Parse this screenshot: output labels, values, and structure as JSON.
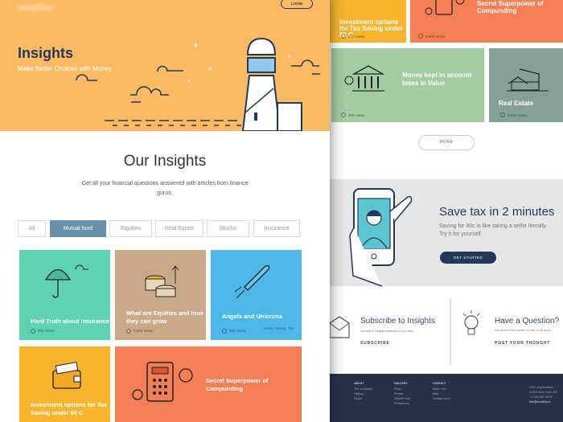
{
  "brand": {
    "logo": "wealthy"
  },
  "header": {
    "login": "LOGIN",
    "title": "Insights",
    "subtitle": "Make Better Choices with Money"
  },
  "section": {
    "title": "Our Insights",
    "description": "Get all your financial questions answered with articles from finance gurus."
  },
  "filters": [
    {
      "label": "All"
    },
    {
      "label": "Mutual fund",
      "active": true
    },
    {
      "label": "Equities"
    },
    {
      "label": "Real Estate"
    },
    {
      "label": "Stocks"
    },
    {
      "label": "Insurance"
    }
  ],
  "cards": [
    {
      "title": "Hard Truth about Insurance",
      "views": "200 Views",
      "color": "#5FD3B0",
      "icon": "umbrella-icon"
    },
    {
      "title": "What are Equities and how they can grow",
      "views": "3,500 Views",
      "color": "#C9A98A",
      "icon": "coins-icon"
    },
    {
      "title": "Angels and Unicrons",
      "views": "300 Views",
      "tags": "Invest, Saving, Tax",
      "color": "#4DB8E8",
      "icon": "rocket-icon"
    },
    {
      "title": "Investment options for Tax Saving under 80 C",
      "views": "300 Views",
      "color": "#F7B52E",
      "icon": "wallet-icon"
    },
    {
      "title": "Secret Superpower of Compunding",
      "views": "3,500 Views",
      "color": "#F47F57",
      "icon": "calculator-icon"
    },
    {
      "title": "Money kept in account loses in Value",
      "views": "300 Views",
      "color": "#A3CCA2",
      "icon": "bank-icon"
    },
    {
      "title": "Real Estate",
      "views": "3,500 Views",
      "color": "#85A097",
      "icon": "house-icon"
    }
  ],
  "more": "MORE",
  "banner": {
    "title": "Save tax in 2 minutes",
    "text": "Saving for 80c is like taking a selfie literally. Try it for yourself",
    "button": "GET STARTED"
  },
  "subscribe": {
    "title": "Subscribe to Insights",
    "text": "Get best of Insights delivered to your inbox",
    "link": "SUBSCRIBE"
  },
  "question": {
    "title": "Have a Question?",
    "text": "Get advice from experts, for free, in 48 hours",
    "link": "POST YOUR THOUGHT"
  },
  "footer": {
    "about": {
      "title": "ABOUT",
      "items": [
        "The company",
        "History",
        "Vision"
      ]
    },
    "gallery": {
      "title": "GALLERY",
      "items": [
        "Flickr",
        "Picasa",
        "iStockPhoto",
        "PhotoDune"
      ]
    },
    "contact": {
      "title": "CONTACT",
      "items": [
        "Basic Info",
        "Map",
        "Contact form"
      ]
    },
    "address": [
      "125 Long Avenue,",
      "12000 New York, NY",
      "+1 234 567 8478",
      "info@wealthy.in"
    ]
  }
}
